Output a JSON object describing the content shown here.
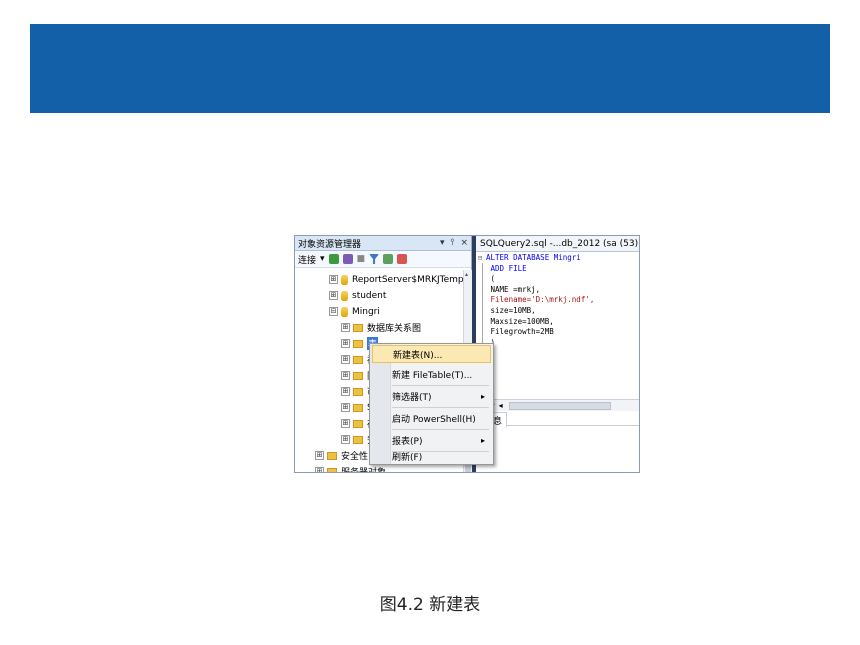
{
  "caption": "图4.2  新建表",
  "object_explorer": {
    "title": "对象资源管理器",
    "title_controls": [
      "▾",
      "⫯",
      "×"
    ],
    "toolbar_connect": "连接",
    "tree": [
      {
        "label": "ReportServer$MRKJTempD",
        "kind": "db",
        "expander": "⊞"
      },
      {
        "label": "student",
        "kind": "db",
        "expander": "⊞"
      },
      {
        "label": "Mingri",
        "kind": "db",
        "expander": "⊟"
      },
      {
        "label": "数据库关系图",
        "kind": "folder",
        "expander": "⊞"
      },
      {
        "label": "表",
        "kind": "folder",
        "expander": "⊞"
      },
      {
        "label": "视",
        "kind": "folder",
        "expander": "⊞"
      },
      {
        "label": "同",
        "kind": "folder",
        "expander": "⊞"
      },
      {
        "label": "可",
        "kind": "folder",
        "expander": "⊞"
      },
      {
        "label": "S",
        "kind": "folder",
        "expander": "⊞"
      },
      {
        "label": "存",
        "kind": "folder",
        "expander": "⊞"
      },
      {
        "label": "安",
        "kind": "folder",
        "expander": "⊞"
      },
      {
        "label": "安全性",
        "kind": "folder",
        "expander": "⊞"
      },
      {
        "label": "服务器对象",
        "kind": "folder",
        "expander": "⊞"
      }
    ]
  },
  "editor": {
    "tab_label": "SQLQuery2.sql -...db_2012 (sa (53))*",
    "tab_close": "×",
    "code_lines": [
      {
        "text": "ALTER DATABASE Mingri",
        "type": "kw"
      },
      {
        "text": " ADD FILE",
        "type": "kw"
      },
      {
        "text": " (",
        "type": "plain"
      },
      {
        "text": " NAME =mrkj,",
        "type": "plain"
      },
      {
        "text": " Filename='D:\\mrkj.ndf',",
        "type": "str"
      },
      {
        "text": " size=10MB,",
        "type": "plain"
      },
      {
        "text": " Maxsize=100MB,",
        "type": "plain"
      },
      {
        "text": " Filegrowth=2MB",
        "type": "plain"
      },
      {
        "text": " )",
        "type": "plain"
      }
    ],
    "zoom_label": "%",
    "messages_tab": "消息"
  },
  "context_menu": {
    "items": [
      {
        "label": "新建表(N)...",
        "submenu": false,
        "selected": true
      },
      {
        "label": "新建 FileTable(T)...",
        "submenu": false,
        "selected": false
      },
      {
        "label": "筛选器(T)",
        "submenu": true,
        "selected": false
      },
      {
        "label": "启动 PowerShell(H)",
        "submenu": false,
        "selected": false
      },
      {
        "label": "报表(P)",
        "submenu": true,
        "selected": false
      },
      {
        "label": "刷新(F)",
        "submenu": false,
        "selected": false
      }
    ],
    "submenu_arrow": "▸"
  },
  "colors": {
    "banner": "#1460a8",
    "selection": "#fbe8b2",
    "keyword": "#0000ff",
    "string": "#a31515"
  }
}
